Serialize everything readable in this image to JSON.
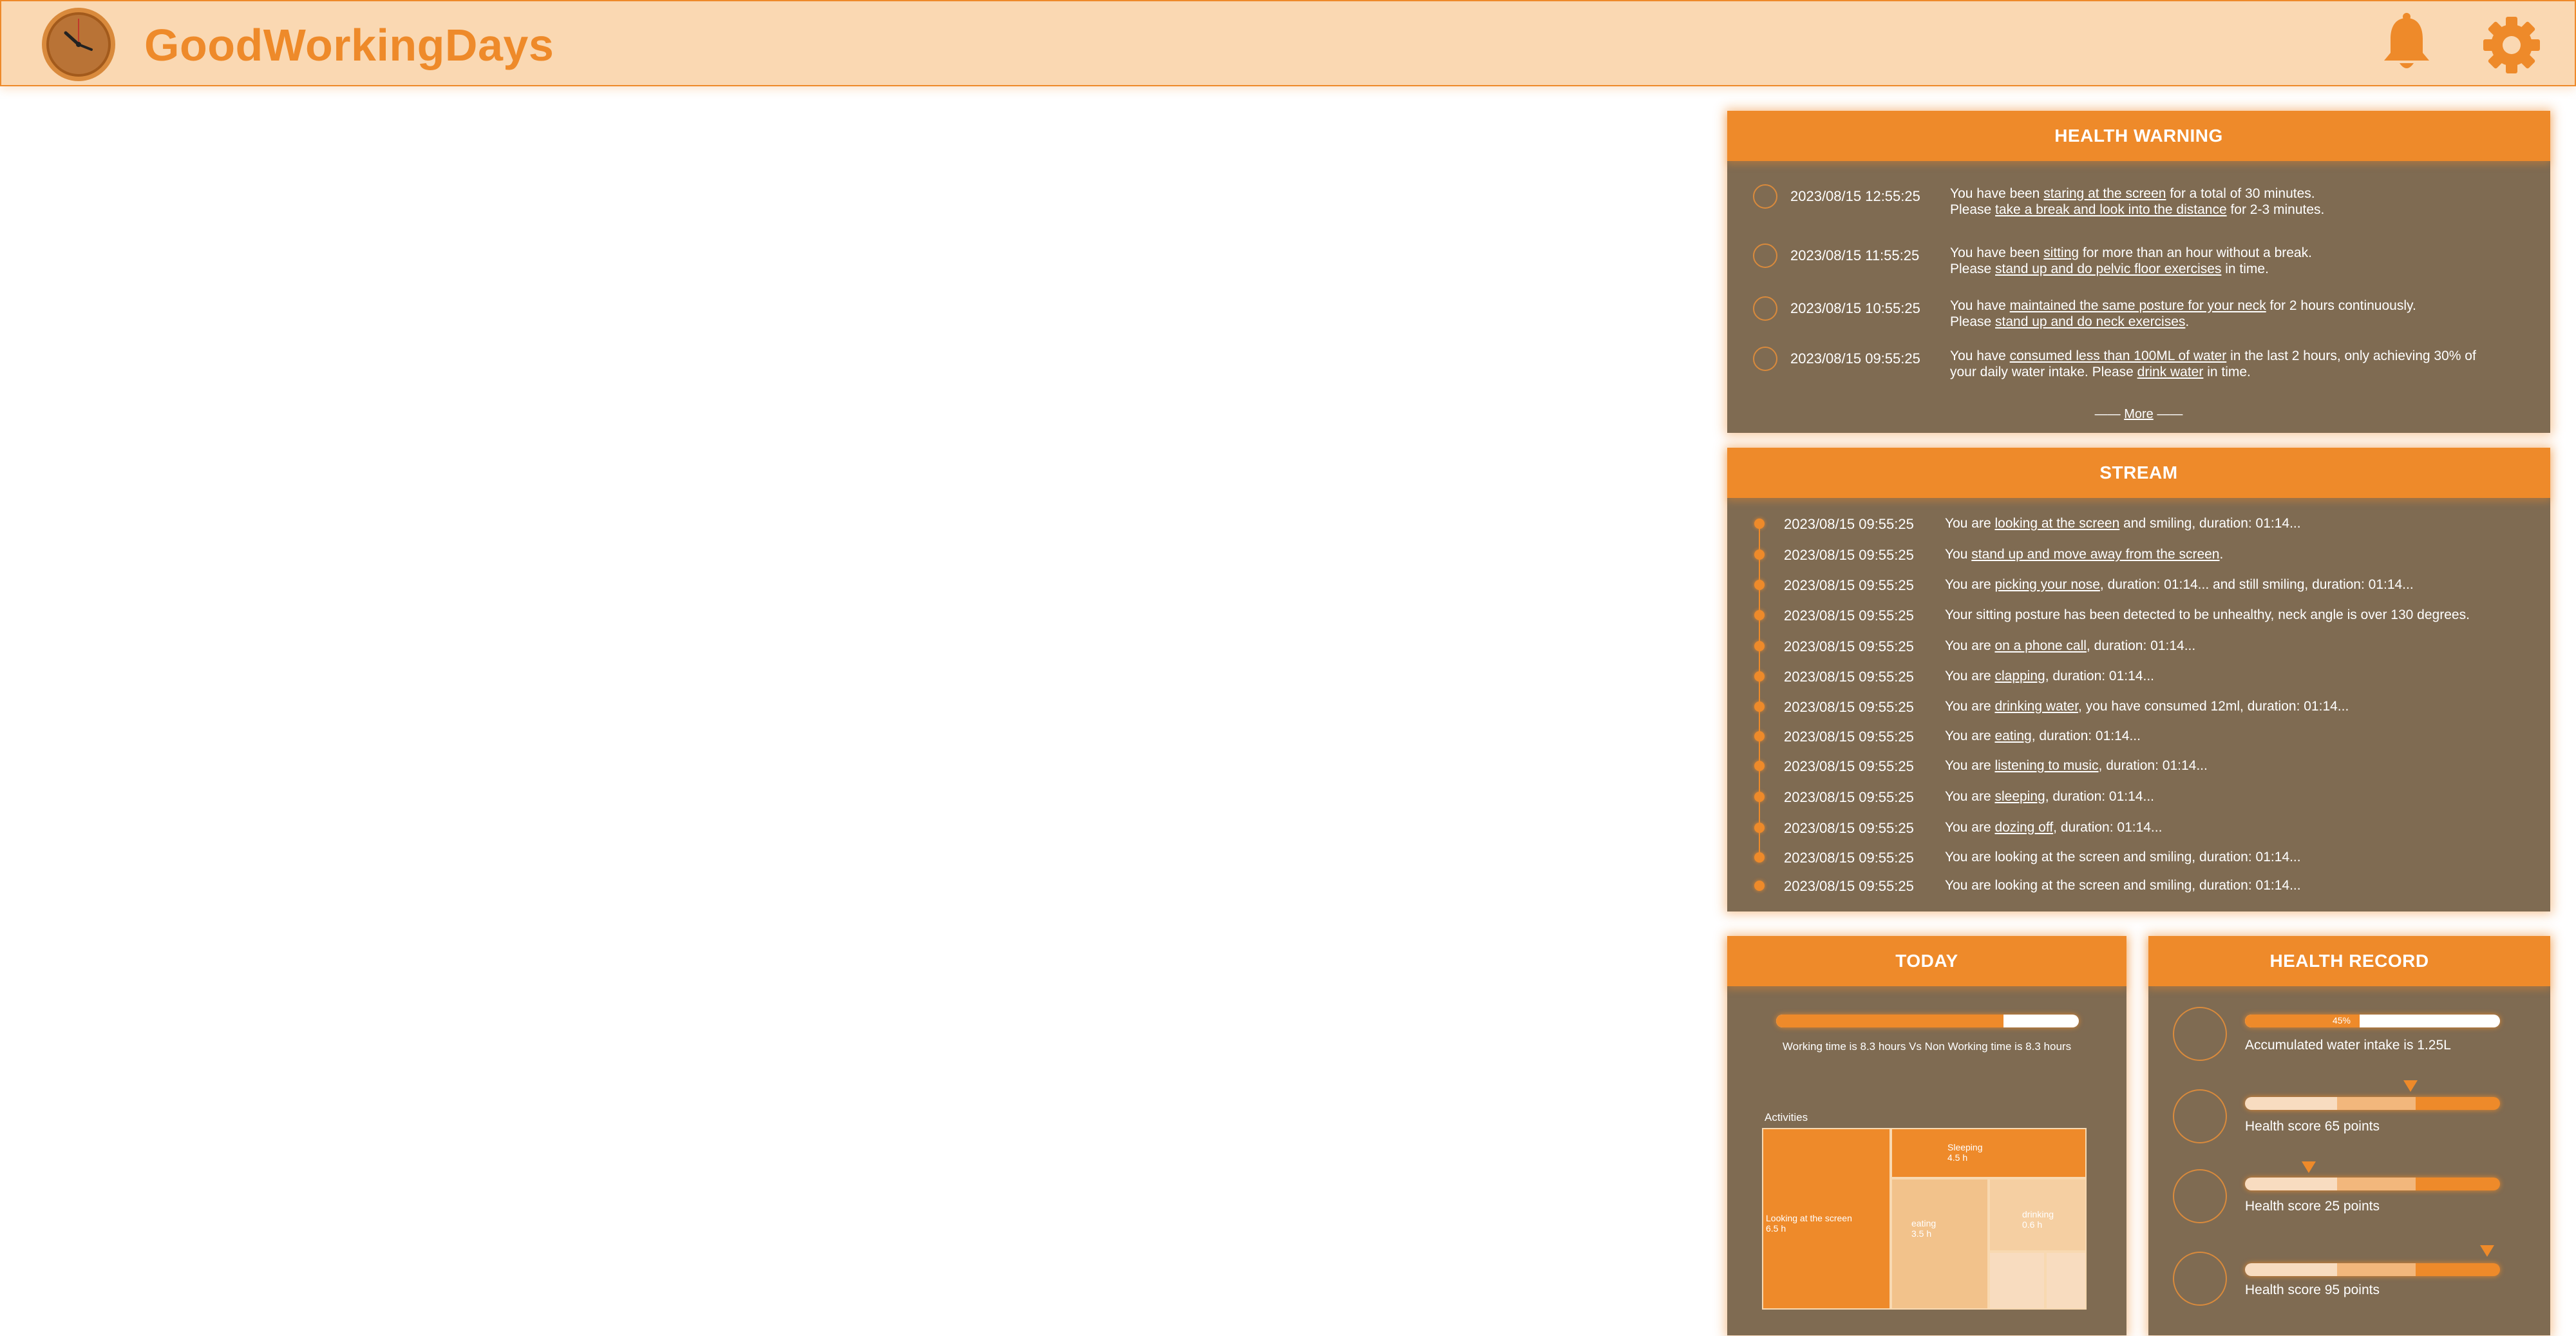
{
  "app": {
    "title": "GoodWorkingDays"
  },
  "health_warning": {
    "title": "HEALTH WARNING",
    "items": [
      {
        "time": "2023/08/15 12:55:25",
        "icon": "eye-icon",
        "l1a": "You have been ",
        "l1b": "staring at the screen",
        "l1c": " for a total of 30 minutes.",
        "l2a": "Please ",
        "l2b": "take a break and look into the distance",
        "l2c": " for 2-3 minutes."
      },
      {
        "time": "2023/08/15 11:55:25",
        "icon": "sitting-icon",
        "l1a": "You have been ",
        "l1b": "sitting",
        "l1c": " for more than an hour without a break.",
        "l2a": "Please ",
        "l2b": "stand up and do pelvic floor exercises",
        "l2c": " in time."
      },
      {
        "time": "2023/08/15 10:55:25",
        "icon": "neck-icon",
        "l1a": "You have ",
        "l1b": "maintained the same posture for your neck",
        "l1c": " for 2 hours continuously.",
        "l2a": "Please ",
        "l2b": "stand up and do neck exercises",
        "l2c": "."
      },
      {
        "time": "2023/08/15 09:55:25",
        "icon": "water-cup-icon",
        "l1a": "You have ",
        "l1b": "consumed less than 100ML of water",
        "l1c": " in the last 2 hours, only achieving 30% of",
        "l2a": "your daily water intake. Please ",
        "l2b": "drink water",
        "l2c": " in time."
      }
    ],
    "more_label": "More"
  },
  "stream": {
    "title": "STREAM",
    "items": [
      {
        "time": "2023/08/15 09:55:25",
        "a": "You are ",
        "b": "looking at the screen",
        "c": " and smiling, duration: 01:14..."
      },
      {
        "time": "2023/08/15 09:55:25",
        "a": "You ",
        "b": "stand up and move away from the screen",
        "c": "."
      },
      {
        "time": "2023/08/15 09:55:25",
        "a": "You are ",
        "b": "picking your nose",
        "c": ", duration: 01:14... and still smiling, duration: 01:14..."
      },
      {
        "time": "2023/08/15 09:55:25",
        "a": "Your sitting posture has been detected to be unhealthy, neck angle is over 130 degrees.",
        "b": "",
        "c": ""
      },
      {
        "time": "2023/08/15 09:55:25",
        "a": "You are ",
        "b": "on a phone call",
        "c": ", duration: 01:14..."
      },
      {
        "time": "2023/08/15 09:55:25",
        "a": "You are ",
        "b": "clapping",
        "c": ", duration: 01:14..."
      },
      {
        "time": "2023/08/15 09:55:25",
        "a": "You are ",
        "b": "drinking water",
        "c": ", you have consumed 12ml, duration: 01:14..."
      },
      {
        "time": "2023/08/15 09:55:25",
        "a": "You are ",
        "b": "eating",
        "c": ", duration: 01:14..."
      },
      {
        "time": "2023/08/15 09:55:25",
        "a": "You are ",
        "b": "listening to music",
        "c": ", duration: 01:14..."
      },
      {
        "time": "2023/08/15 09:55:25",
        "a": "You are ",
        "b": "sleeping",
        "c": ", duration: 01:14..."
      },
      {
        "time": "2023/08/15 09:55:25",
        "a": "You are ",
        "b": "dozing off",
        "c": ", duration: 01:14..."
      },
      {
        "time": "2023/08/15 09:55:25",
        "a": "You are looking at the screen and smiling, duration: 01:14...",
        "b": "",
        "c": ""
      },
      {
        "time": "2023/08/15 09:55:25",
        "a": "You are looking at the screen and smiling, duration: 01:14...",
        "b": "",
        "c": ""
      }
    ]
  },
  "today": {
    "title": "TODAY",
    "working_fraction": 0.75,
    "summary": "Working time is 8.3 hours Vs Non Working time is 8.3 hours",
    "activities_label": "Activities",
    "activities": [
      {
        "name": "Looking at the screen",
        "value": "6.5 h"
      },
      {
        "name": "Sleeping",
        "value": "4.5 h"
      },
      {
        "name": "eating",
        "value": "3.5 h"
      },
      {
        "name": "drinking",
        "value": "0.6 h"
      }
    ]
  },
  "health_record": {
    "title": "HEALTH RECORD",
    "water": {
      "percent_label": "45%",
      "fraction": 0.45,
      "label": "Accumulated water intake is 1.25L",
      "icon": "water-cup-icon"
    },
    "scores": [
      {
        "label": "Health score 65 points",
        "score": 65,
        "icon": "eye-icon"
      },
      {
        "label": "Health score 25 points",
        "score": 25,
        "icon": "neck-icon"
      },
      {
        "label": "Health score 95 points",
        "score": 95,
        "icon": "chair-icon"
      }
    ]
  },
  "colors": {
    "accent": "#ee8a2a",
    "panel_bg": "#7f6b52",
    "header_bg": "#fad8b2"
  }
}
